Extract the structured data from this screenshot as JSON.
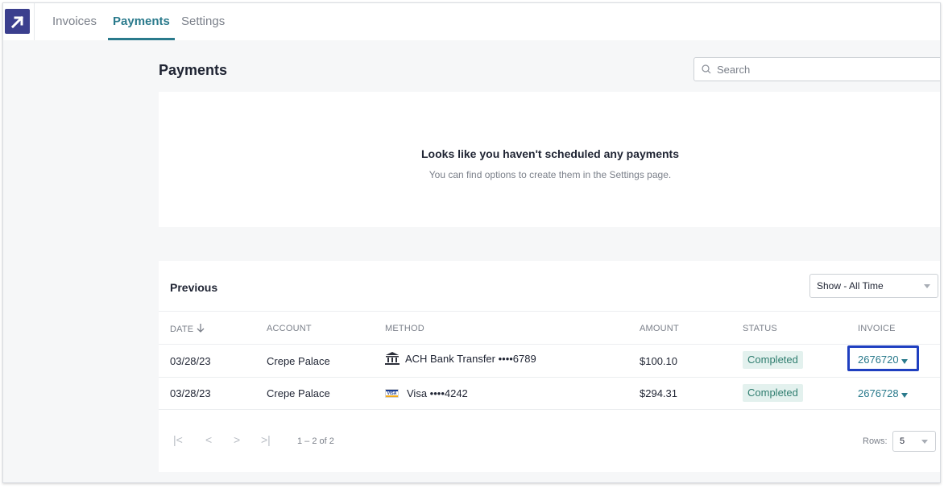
{
  "nav": {
    "logo_icon": "arrow-up-right-icon",
    "tabs": [
      {
        "label": "Invoices",
        "active": false
      },
      {
        "label": "Payments",
        "active": true
      },
      {
        "label": "Settings",
        "active": false
      }
    ]
  },
  "page": {
    "title": "Payments",
    "search_placeholder": "Search"
  },
  "scheduled": {
    "empty_title": "Looks like you haven't scheduled any payments",
    "empty_subtitle": "You can find options to create them in the Settings page."
  },
  "previous": {
    "title": "Previous",
    "filter_value": "Show - All Time",
    "columns": [
      "DATE",
      "ACCOUNT",
      "METHOD",
      "AMOUNT",
      "STATUS",
      "INVOICE"
    ],
    "rows": [
      {
        "date": "03/28/23",
        "account": "Crepe Palace",
        "method_icon": "bank-icon",
        "method": "ACH Bank Transfer ••••6789",
        "amount": "$100.10",
        "status": "Completed",
        "invoice": "2676720"
      },
      {
        "date": "03/28/23",
        "account": "Crepe Palace",
        "method_icon": "visa-card-icon",
        "method": "Visa ••••4242",
        "amount": "$294.31",
        "status": "Completed",
        "invoice": "2676728"
      }
    ],
    "pagination": {
      "first": "|<",
      "prev": "<",
      "next": ">",
      "last": ">|",
      "range": "1 – 2 of 2",
      "rows_label": "Rows:",
      "rows_value": "5"
    }
  },
  "colors": {
    "accent": "#2a7a8c",
    "brand": "#3b3f8e",
    "status_bg": "#e3f1ee",
    "status_text": "#2f7d6f",
    "highlight": "#1f3fc0"
  }
}
